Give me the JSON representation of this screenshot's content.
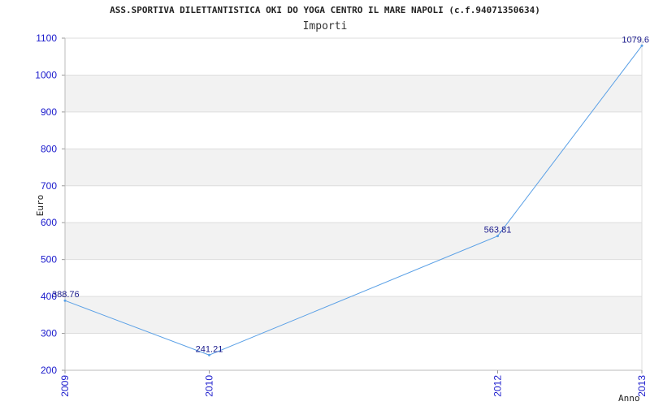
{
  "chart_data": {
    "type": "line",
    "title": "ASS.SPORTIVA DILETTANTISTICA OKI DO YOGA CENTRO IL MARE NAPOLI (c.f.94071350634)",
    "subtitle": "Importi",
    "xlabel": "Anno",
    "ylabel": "Euro",
    "x": [
      "2009",
      "2010",
      "2012",
      "2013"
    ],
    "series": [
      {
        "values": [
          388.76,
          241.21,
          563.81,
          1079.6
        ],
        "labels": [
          "388.76",
          "241.21",
          "563.81",
          "1079.6"
        ]
      }
    ],
    "ylim": [
      200,
      1100
    ],
    "yticks": [
      200,
      300,
      400,
      500,
      600,
      700,
      800,
      900,
      1000,
      1100
    ],
    "grid": true,
    "colors": {
      "line": "#5aa0e6",
      "band": "#f2f2f2",
      "grid": "#dddddd",
      "tick": "#1a1acc"
    }
  }
}
